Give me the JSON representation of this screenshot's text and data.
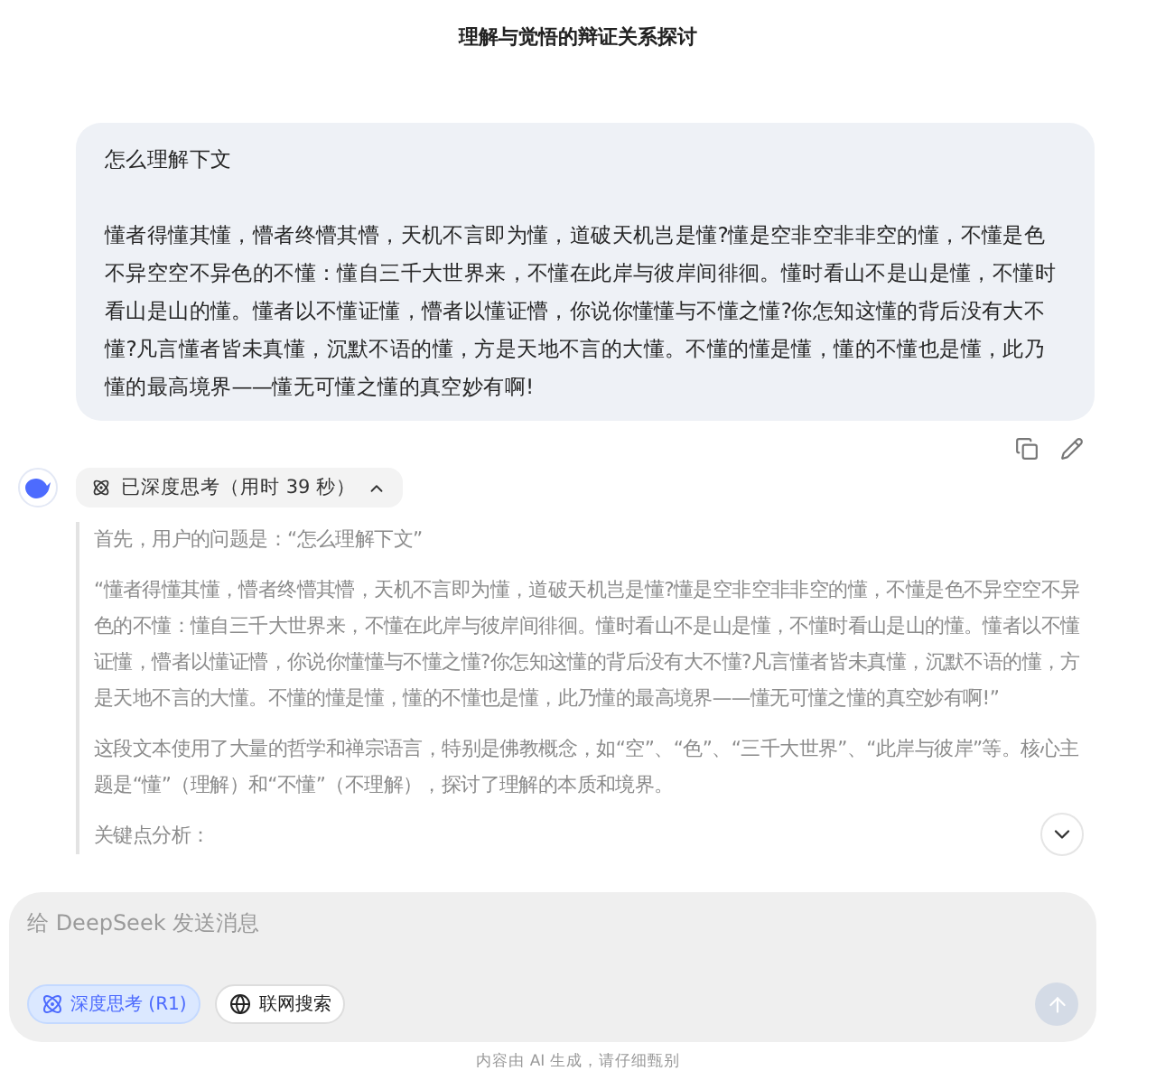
{
  "title": "理解与觉悟的辩证关系探讨",
  "user_message": {
    "paragraphs": [
      "怎么理解下文",
      "懂者得懂其懂，懵者终懵其懵，天机不言即为懂，道破天机岂是懂?懂是空非空非非空的懂，不懂是色不异空空不异色的不懂：懂自三千大世界来，不懂在此岸与彼岸间徘徊。懂时看山不是山是懂，不懂时看山是山的懂。懂者以不懂证懂，懵者以懂证懵，你说你懂懂与不懂之懂?你怎知这懂的背后没有大不懂?凡言懂者皆未真懂，沉默不语的懂，方是天地不言的大懂。不懂的懂是懂，懂的不懂也是懂，此乃懂的最高境界——懂无可懂之懂的真空妙有啊!"
    ]
  },
  "thinking": {
    "label": "已深度思考（用时 39 秒）",
    "expanded": true,
    "paragraphs": [
      "首先，用户的问题是：“怎么理解下文”",
      "“懂者得懂其懂，懵者终懵其懵，天机不言即为懂，道破天机岂是懂?懂是空非空非非空的懂，不懂是色不异空空不异色的不懂：懂自三千大世界来，不懂在此岸与彼岸间徘徊。懂时看山不是山是懂，不懂时看山是山的懂。懂者以不懂证懂，懵者以懂证懵，你说你懂懂与不懂之懂?你怎知这懂的背后没有大不懂?凡言懂者皆未真懂，沉默不语的懂，方是天地不言的大懂。不懂的懂是懂，懂的不懂也是懂，此乃懂的最高境界——懂无可懂之懂的真空妙有啊!”",
      "这段文本使用了大量的哲学和禅宗语言，特别是佛教概念，如“空”、“色”、“三千大世界”、“此岸与彼岸”等。核心主题是“懂”（理解）和“不懂”（不理解），探讨了理解的本质和境界。",
      "关键点分析："
    ]
  },
  "composer": {
    "placeholder": "给 DeepSeek 发送消息",
    "toggles": [
      {
        "label": "深度思考 (R1)",
        "selected": true
      },
      {
        "label": "联网搜索",
        "selected": false
      }
    ],
    "send_disabled": true
  },
  "disclaimer": "内容由 AI 生成，请仔细甄别"
}
